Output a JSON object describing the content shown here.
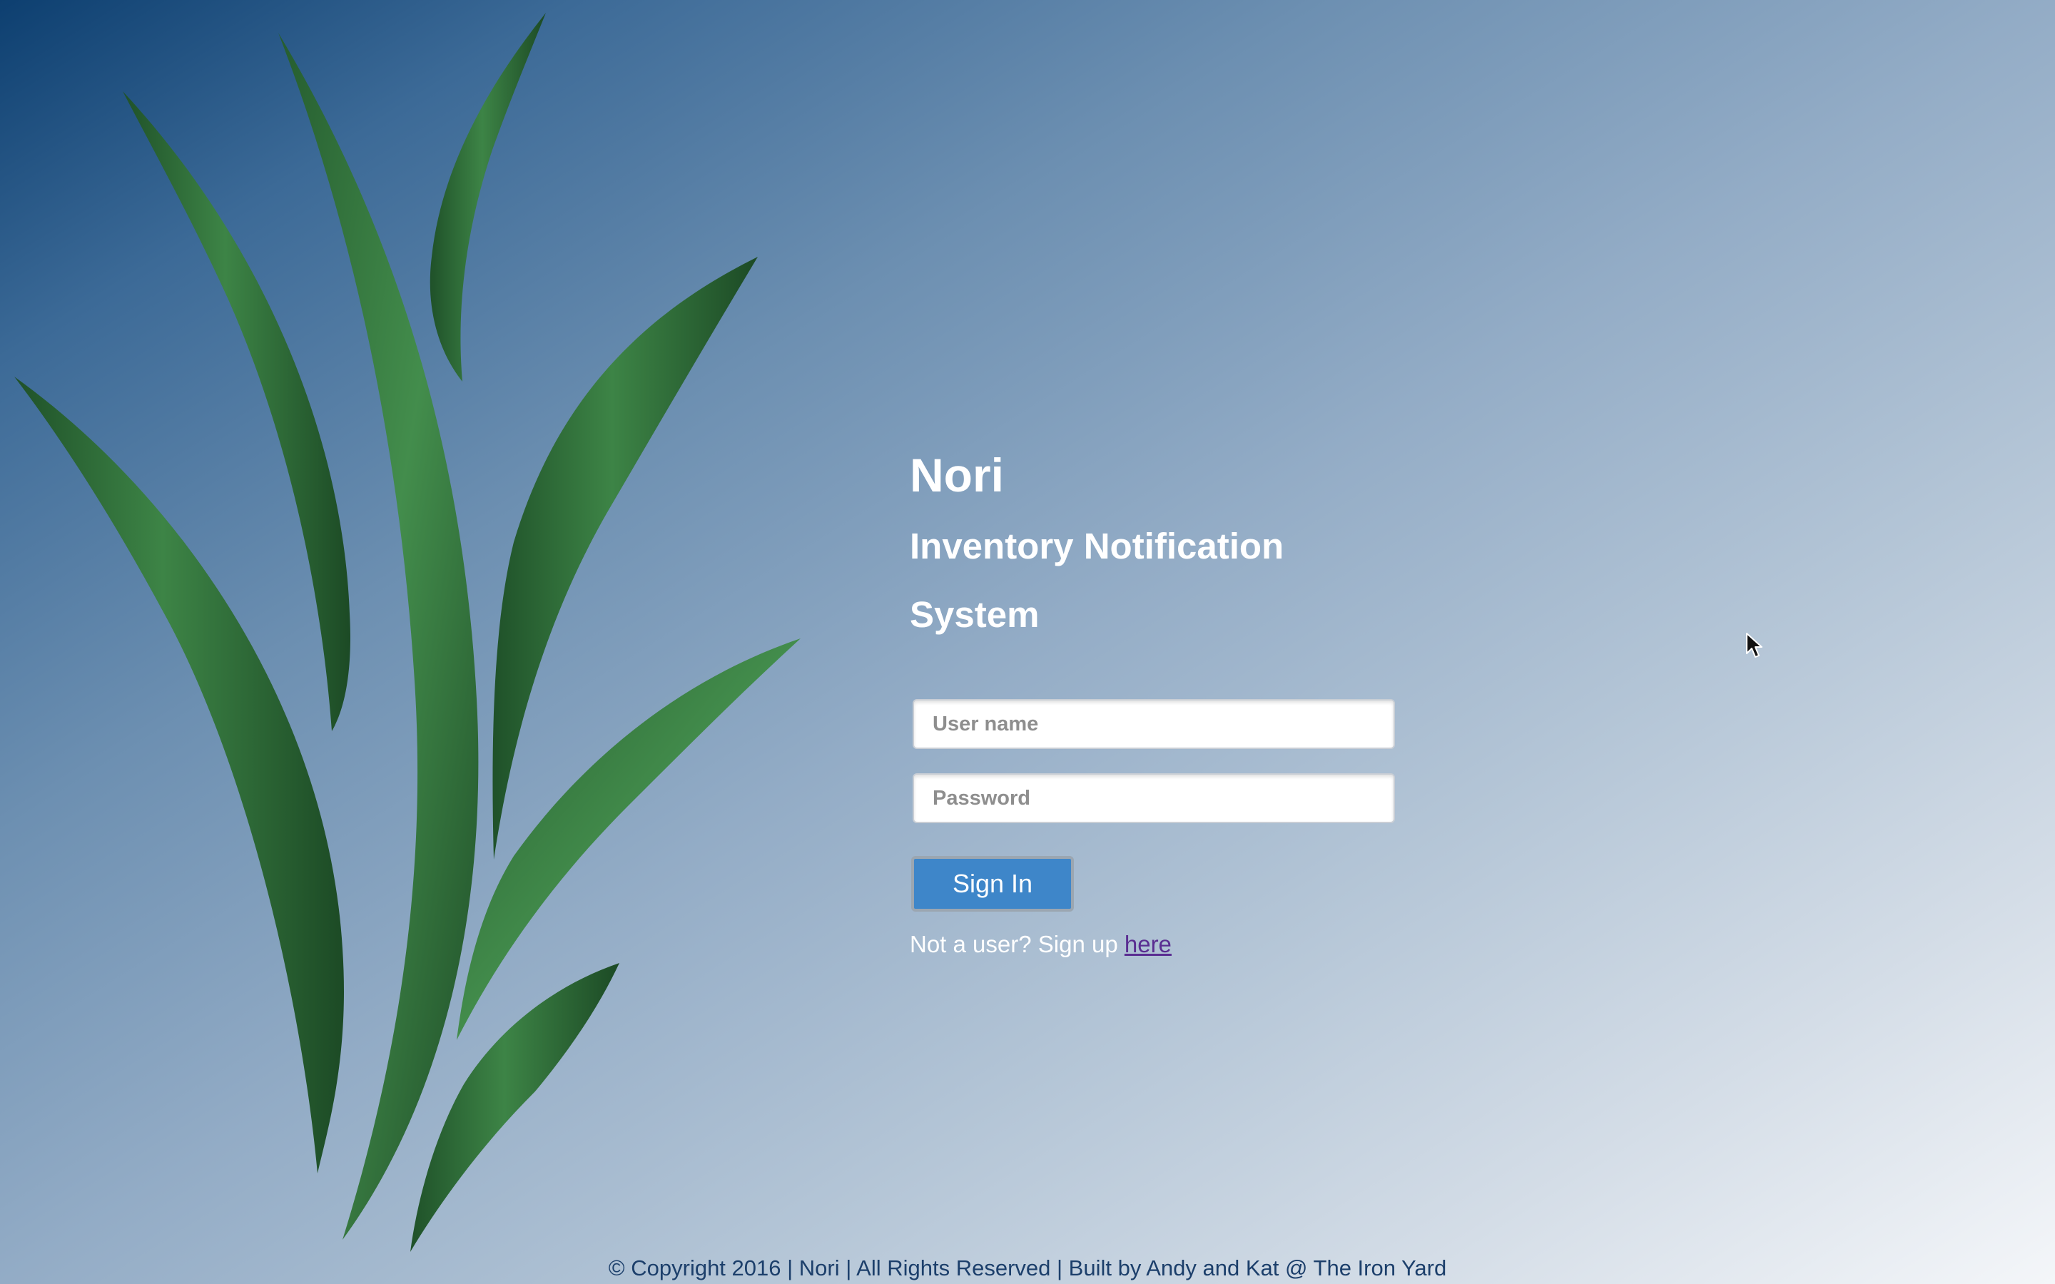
{
  "app": {
    "title": "Nori",
    "subtitle": "Inventory Notification System"
  },
  "login": {
    "username_placeholder": "User name",
    "password_placeholder": "Password",
    "username_value": "",
    "password_value": "",
    "signin_label": "Sign In",
    "signup_prompt": "Not a user? Sign up ",
    "signup_link": "here"
  },
  "footer": {
    "text": "© Copyright 2016 | Nori | All Rights Reserved | Built by Andy and Kat @ The Iron Yard"
  },
  "colors": {
    "background_top_left": "#0d3f70",
    "background_bottom_right": "#f4f6f9",
    "button": "#3e86c9",
    "link": "#5a2d91",
    "leaf": "#2f6e3a"
  },
  "icons": [
    "leaves-illustration",
    "mouse-pointer-icon"
  ]
}
